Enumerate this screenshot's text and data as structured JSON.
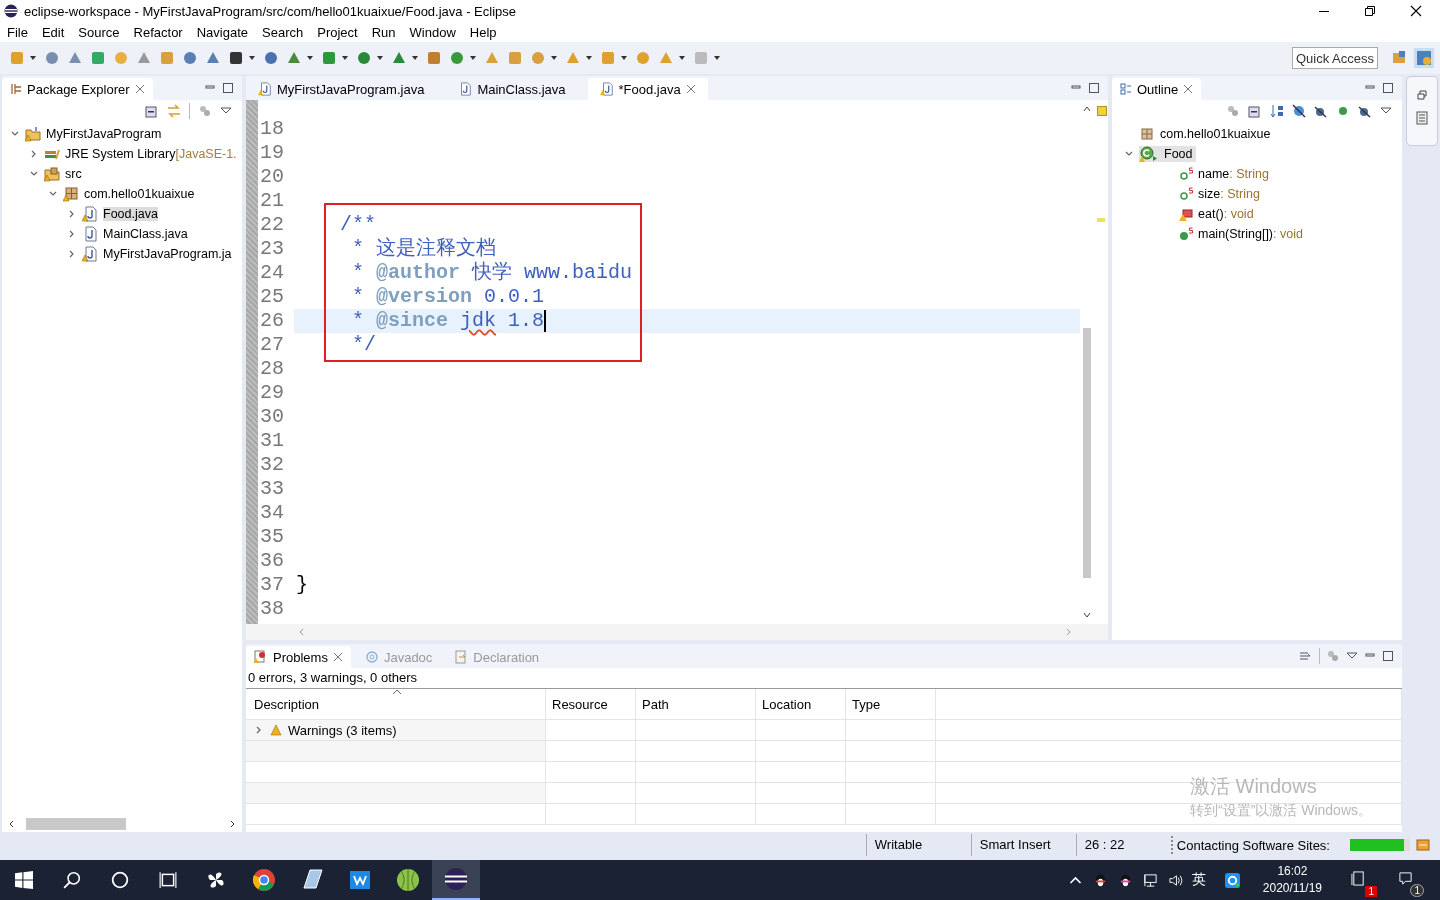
{
  "window": {
    "title": "eclipse-workspace - MyFirstJavaProgram/src/com/hello01kuaixue/Food.java - Eclipse"
  },
  "menu": [
    "File",
    "Edit",
    "Source",
    "Refactor",
    "Navigate",
    "Search",
    "Project",
    "Run",
    "Window",
    "Help"
  ],
  "quick_access": {
    "placeholder": "Quick Access"
  },
  "package_explorer": {
    "title": "Package Explorer",
    "items": [
      {
        "label": "MyFirstJavaProgram",
        "kind": "project",
        "warning": true,
        "expanded": true,
        "selected": false,
        "children": [
          {
            "label": "JRE System Library",
            "suffix": "[JavaSE-1.",
            "kind": "library",
            "warning": false,
            "expanded": false,
            "selected": false
          },
          {
            "label": "src",
            "kind": "folder",
            "warning": true,
            "expanded": true,
            "selected": false,
            "children": [
              {
                "label": "com.hello01kuaixue",
                "kind": "package",
                "warning": true,
                "expanded": true,
                "selected": false,
                "children": [
                  {
                    "label": "Food.java",
                    "kind": "file",
                    "warning": true,
                    "expanded": false,
                    "selected": true
                  },
                  {
                    "label": "MainClass.java",
                    "kind": "file",
                    "warning": false,
                    "expanded": false,
                    "selected": false
                  },
                  {
                    "label": "MyFirstJavaProgram.ja",
                    "kind": "file",
                    "warning": true,
                    "expanded": false,
                    "selected": false
                  }
                ]
              }
            ]
          }
        ]
      }
    ]
  },
  "editor": {
    "tabs": [
      {
        "label": "MyFirstJavaProgram.java",
        "warning": true,
        "selected": false
      },
      {
        "label": "MainClass.java",
        "warning": false,
        "selected": false
      },
      {
        "label": "*Food.java",
        "warning": true,
        "selected": true
      }
    ],
    "lines_above": [
      {
        "number": "18",
        "current": false
      },
      {
        "number": "19",
        "current": false
      },
      {
        "number": "20",
        "current": false
      },
      {
        "number": "21",
        "current": false
      }
    ],
    "framed_lines": [
      {
        "number": "22",
        "current": false,
        "code": [
          {
            "kind": "comment",
            "text": "/**"
          }
        ]
      },
      {
        "number": "23",
        "current": false,
        "code": [
          {
            "kind": "comment",
            "text": " *"
          },
          {
            "kind": "comment",
            "text": "这是注释文档"
          }
        ]
      },
      {
        "number": "24",
        "current": false,
        "code": [
          {
            "kind": "comment",
            "text": " *"
          },
          {
            "kind": "tag",
            "text": "@author"
          },
          {
            "kind": "comment",
            "text": "快学 www.baidu"
          }
        ]
      },
      {
        "number": "25",
        "current": false,
        "code": [
          {
            "kind": "comment",
            "text": " *"
          },
          {
            "kind": "tag",
            "text": "@version"
          },
          {
            "kind": "comment",
            "text": "0.0.1"
          }
        ]
      },
      {
        "number": "26",
        "current": true,
        "code": [
          {
            "kind": "comment",
            "text": " *"
          },
          {
            "kind": "tag",
            "text": "@since"
          },
          {
            "kind": "misspelled",
            "text": "jdk"
          },
          {
            "kind": "comment",
            "text": "1.8"
          }
        ]
      },
      {
        "number": "27",
        "current": false,
        "code": [
          {
            "kind": "comment",
            "text": " */"
          }
        ]
      }
    ],
    "lines_below": [
      {
        "number": "28",
        "current": false
      },
      {
        "number": "29",
        "current": false
      },
      {
        "number": "30",
        "current": false
      },
      {
        "number": "31",
        "current": false
      },
      {
        "number": "32",
        "current": false
      },
      {
        "number": "33",
        "current": false
      },
      {
        "number": "34",
        "current": false
      },
      {
        "number": "35",
        "current": false
      },
      {
        "number": "36",
        "current": false
      },
      {
        "number": "37",
        "current": false,
        "code": [
          {
            "kind": "plain",
            "text": "}"
          }
        ]
      },
      {
        "number": "38",
        "current": false
      }
    ]
  },
  "outline": {
    "title": "Outline",
    "items": [
      {
        "label": "com.hello01kuaixue",
        "kind": "package",
        "selected": false
      },
      {
        "label": "Food",
        "kind": "class",
        "expanded": true,
        "selected": true,
        "children": [
          {
            "label": "name",
            "type": ": String",
            "kind": "package-field",
            "static": true,
            "warning": false
          },
          {
            "label": "size",
            "type": ": String",
            "kind": "package-field",
            "static": true,
            "warning": false
          },
          {
            "label": "eat()",
            "type": ": void",
            "kind": "private-method",
            "static": false,
            "warning": true
          },
          {
            "label": "main(String[])",
            "type": ": void",
            "kind": "public-method",
            "static": true,
            "warning": false
          }
        ]
      }
    ]
  },
  "problems": {
    "tabs": [
      {
        "label": "Problems",
        "selected": true
      },
      {
        "label": "Javadoc",
        "selected": false
      },
      {
        "label": "Declaration",
        "selected": false
      }
    ],
    "summary": "0 errors, 3 warnings, 0 others",
    "columns": [
      "Description",
      "Resource",
      "Path",
      "Location",
      "Type"
    ],
    "rows": [
      {
        "label": "Warnings (3 items)",
        "expanded": false
      }
    ]
  },
  "activation_notice": {
    "title": "激活 Windows",
    "subtitle": "转到“设置”以激活 Windows。"
  },
  "status_bar": {
    "mode": "Writable",
    "insert": "Smart Insert",
    "position": "26 : 22",
    "job": "Contacting Software Sites:",
    "level": 0.9
  },
  "taskbar": {
    "apps": [
      {
        "kind": "pinwheel",
        "selected": false
      },
      {
        "kind": "browser",
        "selected": false
      },
      {
        "kind": "notebook",
        "selected": false
      },
      {
        "kind": "writer",
        "selected": false
      },
      {
        "kind": "ball",
        "selected": false
      },
      {
        "kind": "eclipse",
        "selected": true
      }
    ],
    "input_method": "英",
    "time": "16:02",
    "date": "2020/11/19",
    "notification_count": "1",
    "action_center_count": "1"
  }
}
